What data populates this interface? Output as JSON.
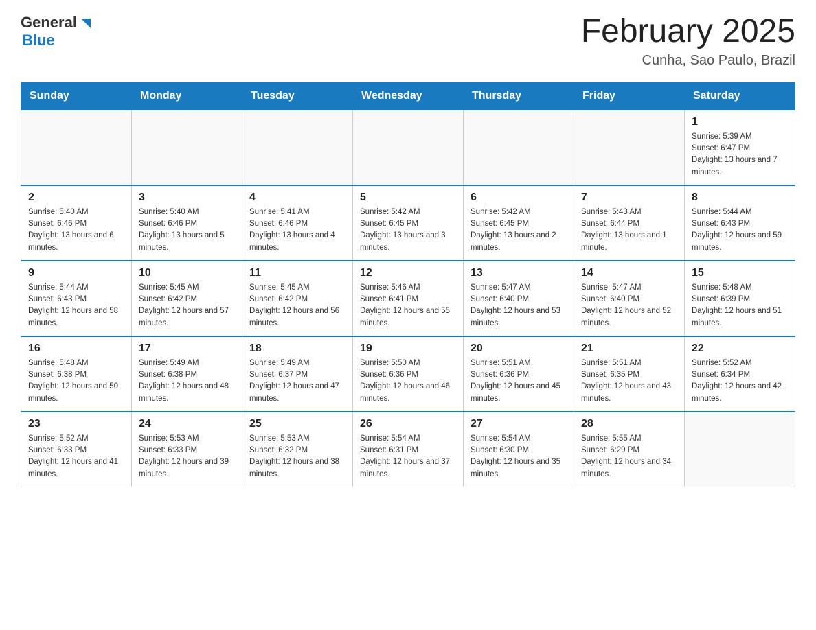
{
  "header": {
    "logo_general": "General",
    "logo_blue": "Blue",
    "month_title": "February 2025",
    "location": "Cunha, Sao Paulo, Brazil"
  },
  "days_of_week": [
    "Sunday",
    "Monday",
    "Tuesday",
    "Wednesday",
    "Thursday",
    "Friday",
    "Saturday"
  ],
  "weeks": [
    [
      {
        "day": "",
        "info": ""
      },
      {
        "day": "",
        "info": ""
      },
      {
        "day": "",
        "info": ""
      },
      {
        "day": "",
        "info": ""
      },
      {
        "day": "",
        "info": ""
      },
      {
        "day": "",
        "info": ""
      },
      {
        "day": "1",
        "info": "Sunrise: 5:39 AM\nSunset: 6:47 PM\nDaylight: 13 hours and 7 minutes."
      }
    ],
    [
      {
        "day": "2",
        "info": "Sunrise: 5:40 AM\nSunset: 6:46 PM\nDaylight: 13 hours and 6 minutes."
      },
      {
        "day": "3",
        "info": "Sunrise: 5:40 AM\nSunset: 6:46 PM\nDaylight: 13 hours and 5 minutes."
      },
      {
        "day": "4",
        "info": "Sunrise: 5:41 AM\nSunset: 6:46 PM\nDaylight: 13 hours and 4 minutes."
      },
      {
        "day": "5",
        "info": "Sunrise: 5:42 AM\nSunset: 6:45 PM\nDaylight: 13 hours and 3 minutes."
      },
      {
        "day": "6",
        "info": "Sunrise: 5:42 AM\nSunset: 6:45 PM\nDaylight: 13 hours and 2 minutes."
      },
      {
        "day": "7",
        "info": "Sunrise: 5:43 AM\nSunset: 6:44 PM\nDaylight: 13 hours and 1 minute."
      },
      {
        "day": "8",
        "info": "Sunrise: 5:44 AM\nSunset: 6:43 PM\nDaylight: 12 hours and 59 minutes."
      }
    ],
    [
      {
        "day": "9",
        "info": "Sunrise: 5:44 AM\nSunset: 6:43 PM\nDaylight: 12 hours and 58 minutes."
      },
      {
        "day": "10",
        "info": "Sunrise: 5:45 AM\nSunset: 6:42 PM\nDaylight: 12 hours and 57 minutes."
      },
      {
        "day": "11",
        "info": "Sunrise: 5:45 AM\nSunset: 6:42 PM\nDaylight: 12 hours and 56 minutes."
      },
      {
        "day": "12",
        "info": "Sunrise: 5:46 AM\nSunset: 6:41 PM\nDaylight: 12 hours and 55 minutes."
      },
      {
        "day": "13",
        "info": "Sunrise: 5:47 AM\nSunset: 6:40 PM\nDaylight: 12 hours and 53 minutes."
      },
      {
        "day": "14",
        "info": "Sunrise: 5:47 AM\nSunset: 6:40 PM\nDaylight: 12 hours and 52 minutes."
      },
      {
        "day": "15",
        "info": "Sunrise: 5:48 AM\nSunset: 6:39 PM\nDaylight: 12 hours and 51 minutes."
      }
    ],
    [
      {
        "day": "16",
        "info": "Sunrise: 5:48 AM\nSunset: 6:38 PM\nDaylight: 12 hours and 50 minutes."
      },
      {
        "day": "17",
        "info": "Sunrise: 5:49 AM\nSunset: 6:38 PM\nDaylight: 12 hours and 48 minutes."
      },
      {
        "day": "18",
        "info": "Sunrise: 5:49 AM\nSunset: 6:37 PM\nDaylight: 12 hours and 47 minutes."
      },
      {
        "day": "19",
        "info": "Sunrise: 5:50 AM\nSunset: 6:36 PM\nDaylight: 12 hours and 46 minutes."
      },
      {
        "day": "20",
        "info": "Sunrise: 5:51 AM\nSunset: 6:36 PM\nDaylight: 12 hours and 45 minutes."
      },
      {
        "day": "21",
        "info": "Sunrise: 5:51 AM\nSunset: 6:35 PM\nDaylight: 12 hours and 43 minutes."
      },
      {
        "day": "22",
        "info": "Sunrise: 5:52 AM\nSunset: 6:34 PM\nDaylight: 12 hours and 42 minutes."
      }
    ],
    [
      {
        "day": "23",
        "info": "Sunrise: 5:52 AM\nSunset: 6:33 PM\nDaylight: 12 hours and 41 minutes."
      },
      {
        "day": "24",
        "info": "Sunrise: 5:53 AM\nSunset: 6:33 PM\nDaylight: 12 hours and 39 minutes."
      },
      {
        "day": "25",
        "info": "Sunrise: 5:53 AM\nSunset: 6:32 PM\nDaylight: 12 hours and 38 minutes."
      },
      {
        "day": "26",
        "info": "Sunrise: 5:54 AM\nSunset: 6:31 PM\nDaylight: 12 hours and 37 minutes."
      },
      {
        "day": "27",
        "info": "Sunrise: 5:54 AM\nSunset: 6:30 PM\nDaylight: 12 hours and 35 minutes."
      },
      {
        "day": "28",
        "info": "Sunrise: 5:55 AM\nSunset: 6:29 PM\nDaylight: 12 hours and 34 minutes."
      },
      {
        "day": "",
        "info": ""
      }
    ]
  ]
}
